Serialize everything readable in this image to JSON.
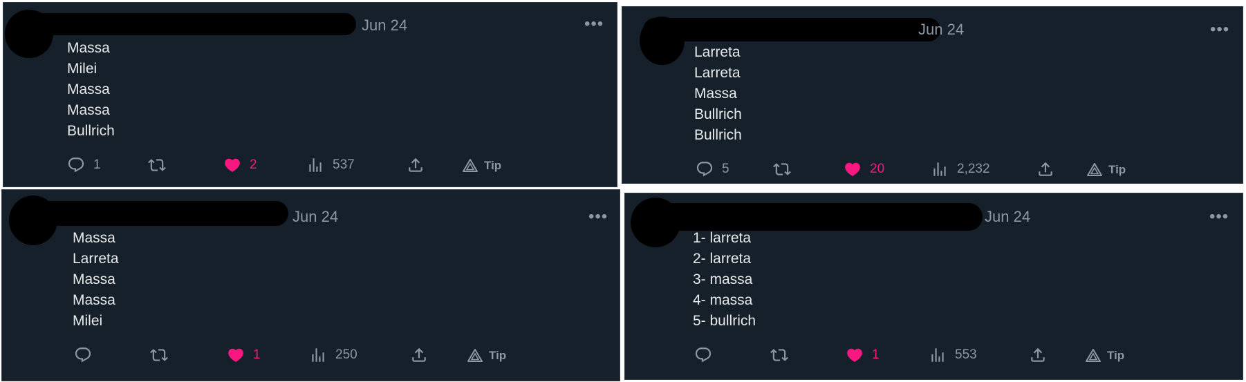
{
  "colors": {
    "background": "#15202b",
    "text": "#e7e9ea",
    "muted": "#8b98a5",
    "like": "#f91880"
  },
  "tweets": [
    {
      "date": "Jun 24",
      "lines": [
        "Massa",
        "Milei",
        "Massa",
        "Massa",
        "Bullrich"
      ],
      "stats": {
        "replies": "1",
        "retweets": "",
        "likes": "2",
        "views": "537",
        "tip": "Tip"
      }
    },
    {
      "date": "Jun 24",
      "lines": [
        "Larreta",
        "Larreta",
        "Massa",
        "Bullrich",
        "Bullrich"
      ],
      "stats": {
        "replies": "5",
        "retweets": "",
        "likes": "20",
        "views": "2,232",
        "tip": "Tip"
      }
    },
    {
      "date": "Jun 24",
      "lines": [
        "Massa",
        "Larreta",
        "Massa",
        "Massa",
        "Milei"
      ],
      "stats": {
        "replies": "",
        "retweets": "",
        "likes": "1",
        "views": "250",
        "tip": "Tip"
      }
    },
    {
      "date": "Jun 24",
      "lines": [
        "1- larreta",
        "2- larreta",
        "3- massa",
        "4- massa",
        "5- bullrich"
      ],
      "stats": {
        "replies": "",
        "retweets": "",
        "likes": "1",
        "views": "553",
        "tip": "Tip"
      }
    }
  ]
}
